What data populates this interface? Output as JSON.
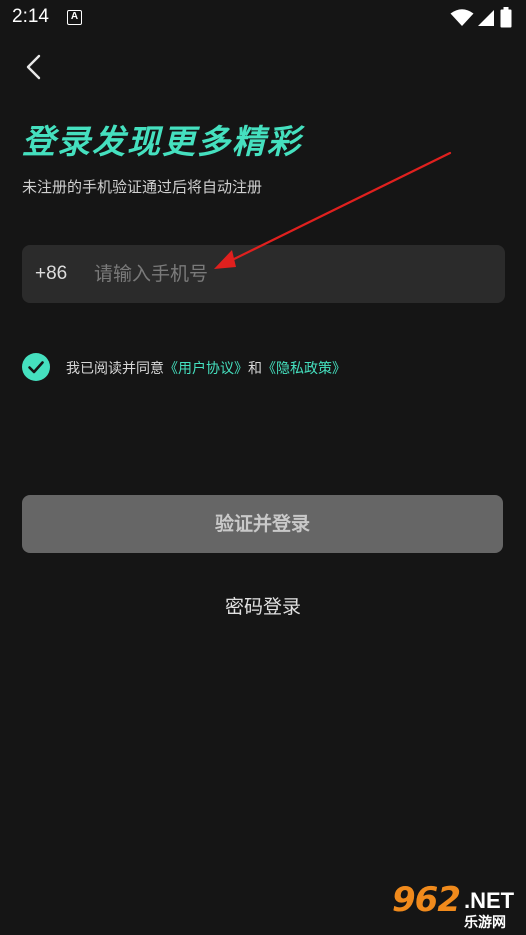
{
  "status_bar": {
    "time": "2:14",
    "notification_glyph": "A"
  },
  "page": {
    "title": "登录发现更多精彩",
    "subtitle": "未注册的手机验证通过后将自动注册"
  },
  "phone": {
    "country_code": "+86",
    "placeholder": "请输入手机号",
    "value": ""
  },
  "agreement": {
    "checked": true,
    "prefix": "我已阅读并同意",
    "user_agreement": "《用户协议》",
    "conjunction": "和",
    "privacy_policy": "《隐私政策》"
  },
  "actions": {
    "login_label": "验证并登录",
    "password_login_label": "密码登录"
  },
  "watermark": {
    "number": "962",
    "domain": ".NET",
    "chinese": "乐游网"
  },
  "colors": {
    "accent": "#45e0bf",
    "background": "#151515",
    "input_bg": "#2b2b2b",
    "button_disabled": "#666666",
    "annotation_arrow": "#e0201e",
    "watermark_orange": "#f08a1c"
  }
}
